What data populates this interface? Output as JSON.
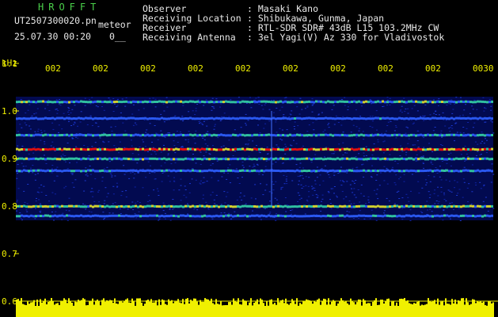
{
  "app": {
    "title": "HROFFT",
    "file_name": "UT2507300020.pn",
    "mode_label": "meteor",
    "datetime": "25.07.30 00:20",
    "counter": "0__"
  },
  "info": {
    "labels": [
      "Observer",
      "Receiving Location",
      "Receiver",
      "Receiving Antenna"
    ],
    "values": [
      ": Masaki Kano",
      ": Shibukawa, Gunma, Japan",
      ": RTL-SDR SDR# 43dB L15 103.2MHz CW",
      ": 3el Yagi(V) Az 330 for Vladivostok"
    ]
  },
  "chart_data": {
    "type": "heatmap",
    "ylabel": "kHz",
    "ytick_labels": [
      "1.1",
      "1.0",
      "0.9",
      "0.8",
      "0.7",
      "0.6"
    ],
    "ylim": [
      0.6,
      1.1
    ],
    "xtick_labels": [
      "002",
      "002",
      "002",
      "002",
      "002",
      "002",
      "002",
      "002",
      "002",
      "0030"
    ],
    "signal_bands_khz": [
      {
        "freq": 1.02,
        "intensity": 0.55
      },
      {
        "freq": 0.985,
        "intensity": 0.35
      },
      {
        "freq": 0.95,
        "intensity": 0.45
      },
      {
        "freq": 0.92,
        "intensity": 1.0
      },
      {
        "freq": 0.9,
        "intensity": 0.55
      },
      {
        "freq": 0.875,
        "intensity": 0.4
      },
      {
        "freq": 0.8,
        "intensity": 0.7
      },
      {
        "freq": 0.78,
        "intensity": 0.4
      }
    ],
    "colors": {
      "background": "#000000",
      "noise": "#0a1a9a",
      "signal": "#e01010",
      "amplitude": "#f0f000",
      "tick": "#f0f000"
    }
  }
}
